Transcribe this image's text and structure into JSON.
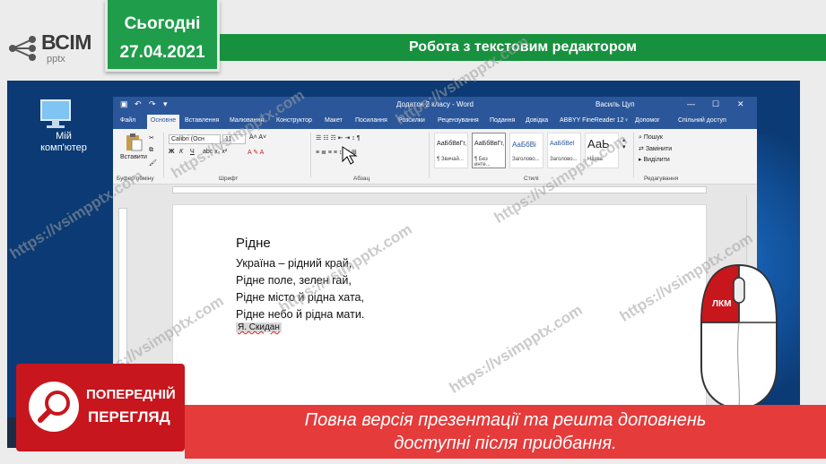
{
  "header": {
    "logo_text": "ВСІМ",
    "logo_sub": "pptx",
    "date_line1": "Сьогодні",
    "date_line2": "27.04.2021",
    "slide_title": "Робота з текстовим редактором"
  },
  "desktop": {
    "icon_label": "Мій комп'ютер"
  },
  "word": {
    "doc_title": "Додаток 2 класу - Word",
    "user_name": "Василь Цуп",
    "tabs": [
      "Файл",
      "Основне",
      "Вставлення",
      "Малювання",
      "Конструктор",
      "Макет",
      "Посилання",
      "Розсилки",
      "Рецензування",
      "Подання",
      "Довідка",
      "ABBYY FineReader 12"
    ],
    "tell_me": "Допомог",
    "share": "Спільний доступ",
    "ribbon": {
      "paste": "Вставити",
      "font_name": "Calibri (Осн",
      "font_size": "11",
      "groups": [
        "Буфер обміну",
        "Шрифт",
        "Абзац",
        "Стилі",
        "Редагування"
      ],
      "styles": [
        {
          "sample": "АаБбВвГг,",
          "name": "¶ Звичай..."
        },
        {
          "sample": "АаБбВвГг,",
          "name": "¶ Без инте..."
        },
        {
          "sample": "АаБбВі",
          "name": "Заголово..."
        },
        {
          "sample": "АаБбВеІ",
          "name": "Заголово..."
        },
        {
          "sample": "АаЬ",
          "name": "Назва"
        }
      ],
      "edit_items": [
        "Пошук",
        "Замінити",
        "Виділити"
      ]
    },
    "document": {
      "title": "Рідне",
      "lines": [
        "Україна – рідний край,",
        "Рідне поле, зелен гай,",
        "Рідне місто й рідна хата,",
        "Рідне небо й рідна мати."
      ],
      "author": "Я. Скидан"
    }
  },
  "mouse_label": "ЛКМ",
  "preview": {
    "line1": "ПОПЕРЕДНІЙ",
    "line2": "ПЕРЕГЛЯД"
  },
  "promo": {
    "line1": "Повна версія презентації та решта доповнень",
    "line2": "доступні після придбання."
  },
  "watermark": "https://vsimpptx.com",
  "colors": {
    "green": "#1f9d4a",
    "word_blue": "#2b579a",
    "preview_red": "#c7161d",
    "promo_red": "#e53b3b"
  }
}
